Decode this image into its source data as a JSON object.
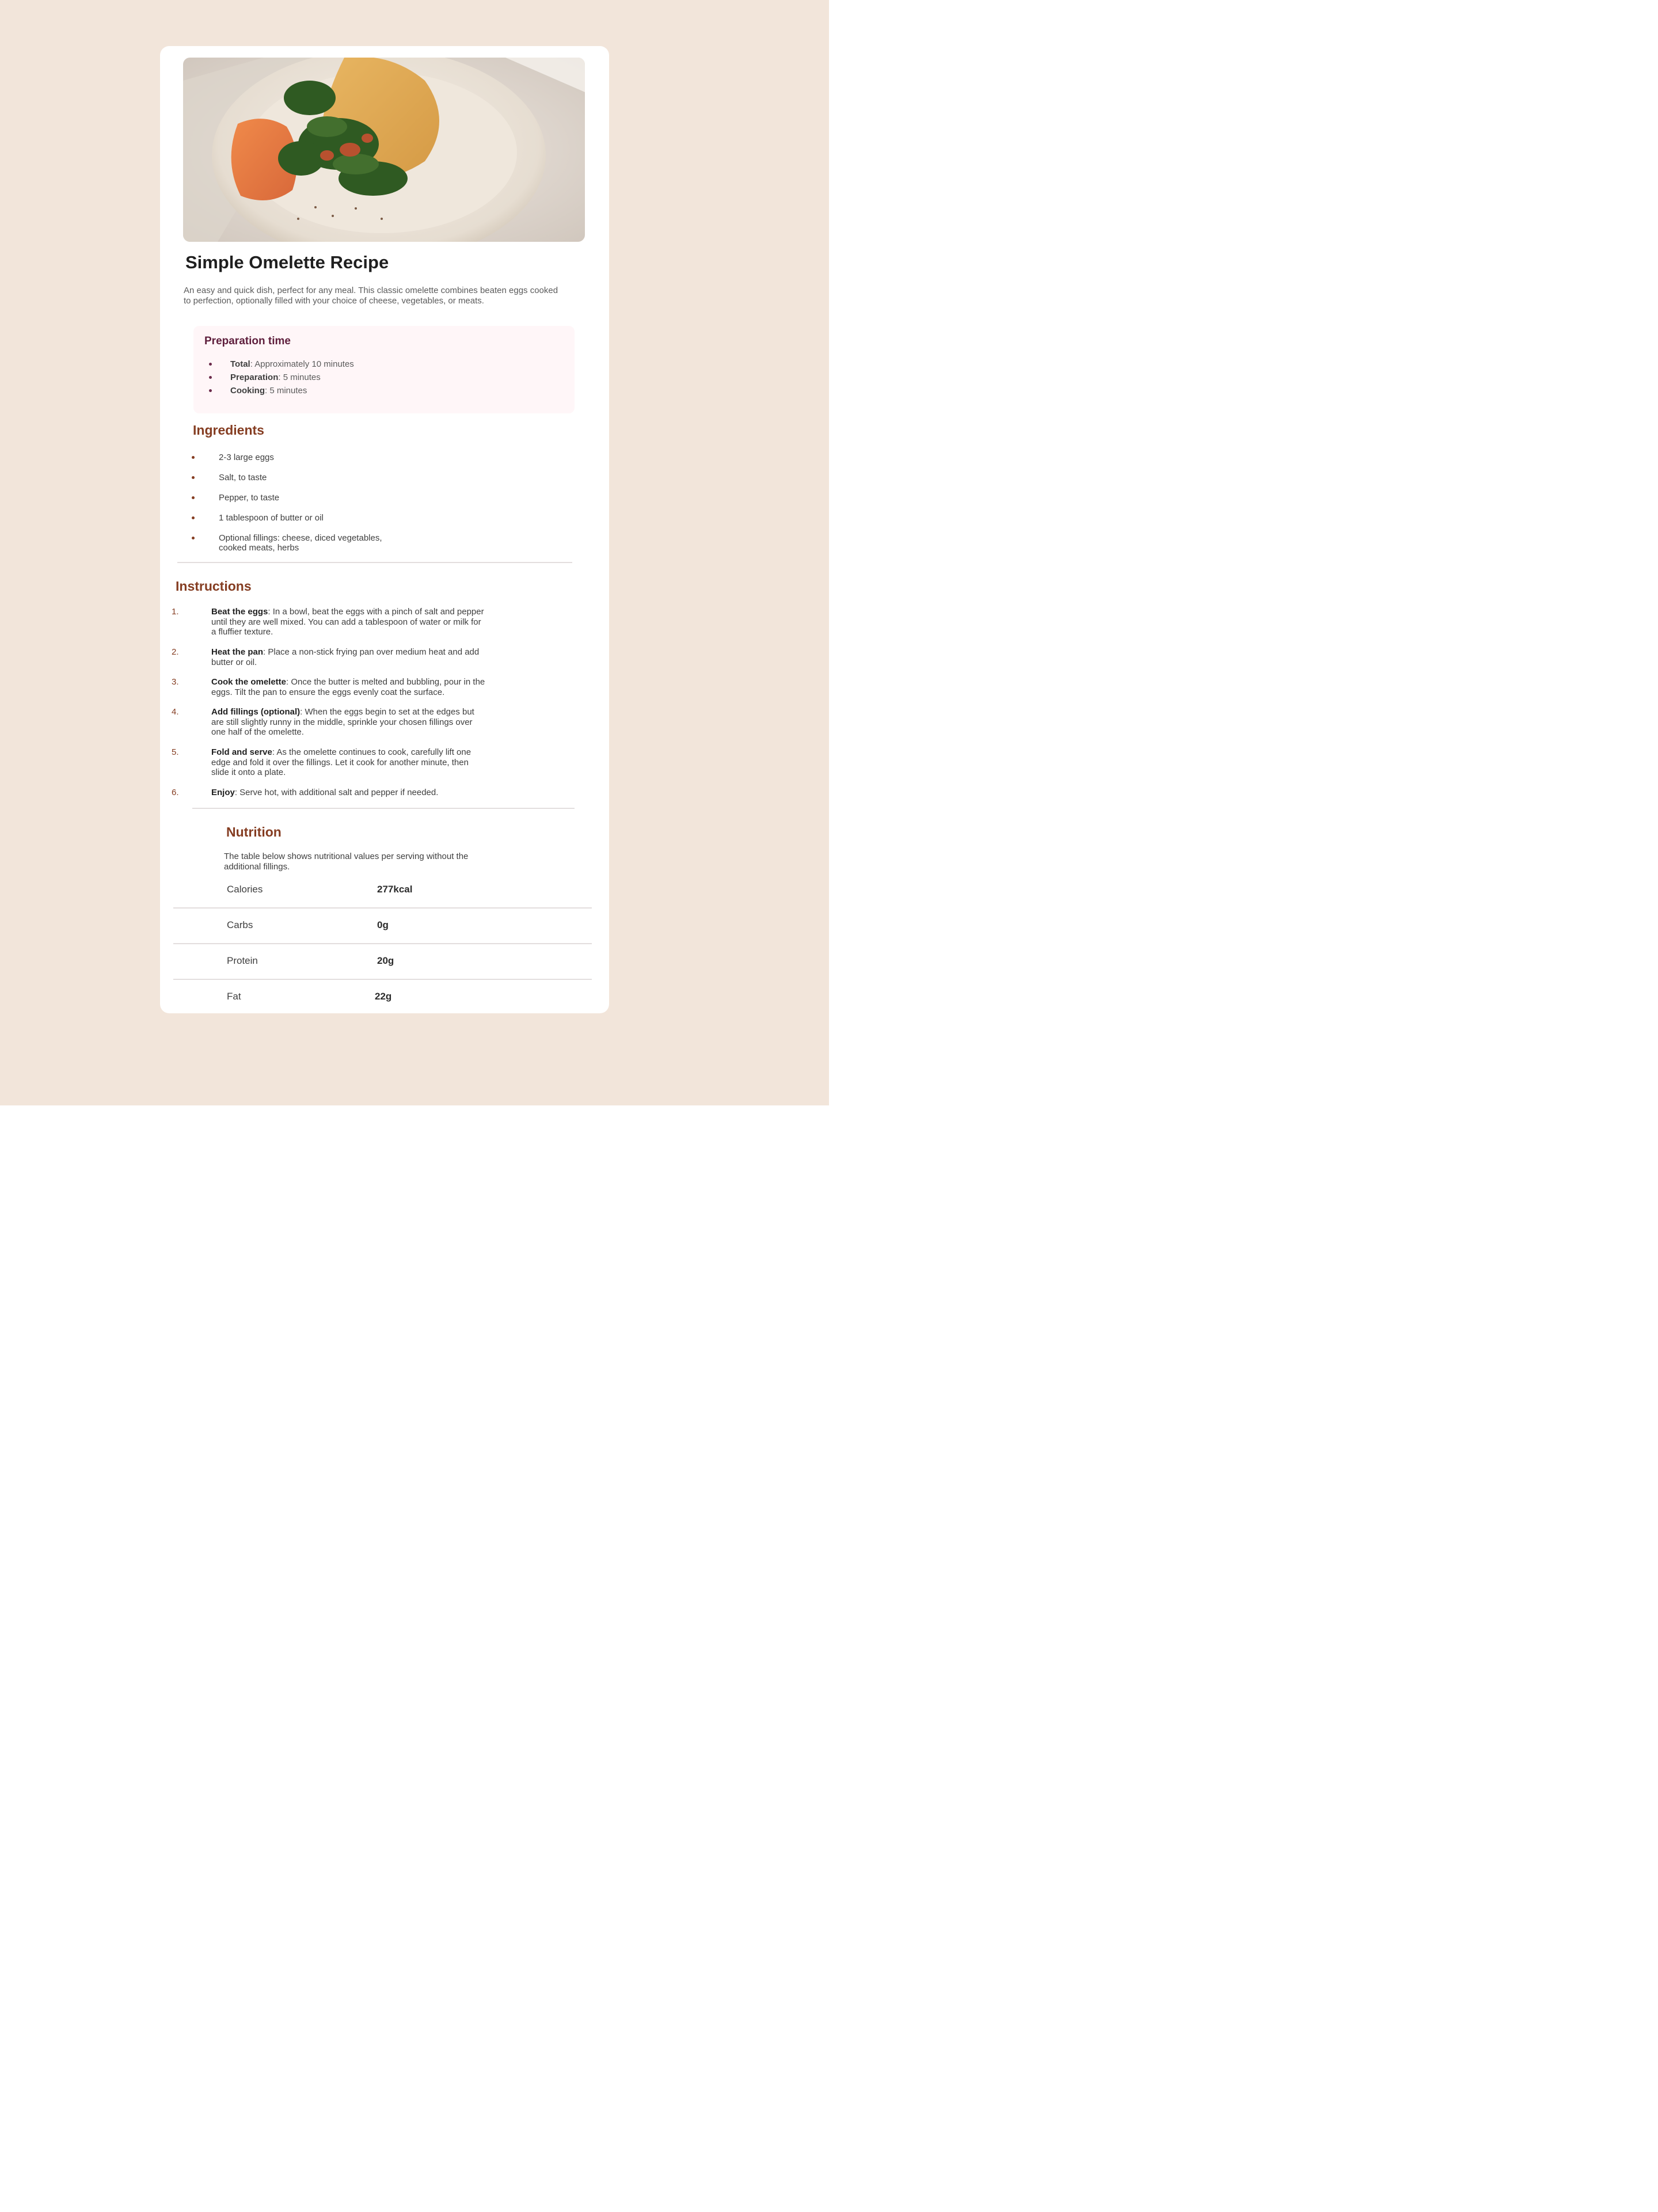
{
  "colors": {
    "page_background": "#f2e5da",
    "card": "#ffffff",
    "accent_brown": "#853d22",
    "prep_heading": "#5e1e3c",
    "prep_background": "#fff6f8"
  },
  "recipe": {
    "image_alt": "omelette-photo",
    "title": "Simple Omelette Recipe",
    "intro": "An easy and quick dish, perfect for any meal. This classic omelette combines beaten eggs cooked to perfection, optionally filled with your choice of cheese, vegetables, or meats."
  },
  "preparation": {
    "title": "Preparation time",
    "items": [
      {
        "label": "Total",
        "value": ": Approximately 10 minutes"
      },
      {
        "label": "Preparation",
        "value": ": 5 minutes"
      },
      {
        "label": "Cooking",
        "value": ": 5 minutes"
      }
    ]
  },
  "ingredients": {
    "title": "Ingredients",
    "items": [
      "2-3 large eggs",
      "Salt, to taste",
      "Pepper, to taste",
      "1 tablespoon of butter or oil",
      "Optional fillings: cheese, diced vegetables, cooked meats, herbs"
    ]
  },
  "instructions": {
    "title": "Instructions",
    "steps": [
      {
        "num": "1.",
        "label": "Beat the eggs",
        "text": ": In a bowl, beat the eggs with a pinch of salt and pepper until they are well mixed. You can add a tablespoon of water or milk for a fluffier texture."
      },
      {
        "num": "2.",
        "label": "Heat the pan",
        "text": ": Place a non-stick frying pan over medium heat and add butter or oil."
      },
      {
        "num": "3.",
        "label": "Cook the omelette",
        "text": ": Once the butter is melted and bubbling, pour in the eggs. Tilt the pan to ensure the eggs evenly coat the surface."
      },
      {
        "num": "4.",
        "label": "Add fillings (optional)",
        "text": ": When the eggs begin to set at the edges but are still slightly runny in the middle, sprinkle your chosen fillings over one half of the omelette."
      },
      {
        "num": "5.",
        "label": "Fold and serve",
        "text": ": As the omelette continues to cook, carefully lift one edge and fold it over the fillings. Let it cook for another minute, then slide it onto a plate."
      },
      {
        "num": "6.",
        "label": "Enjoy",
        "text": ": Serve hot, with additional salt and pepper if needed."
      }
    ]
  },
  "nutrition": {
    "title": "Nutrition",
    "description": "The table below shows nutritional values per serving without the additional fillings.",
    "rows": [
      {
        "label": "Calories",
        "value": "277kcal"
      },
      {
        "label": "Carbs",
        "value": "0g"
      },
      {
        "label": "Protein",
        "value": "20g"
      },
      {
        "label": "Fat",
        "value": "22g"
      }
    ]
  }
}
